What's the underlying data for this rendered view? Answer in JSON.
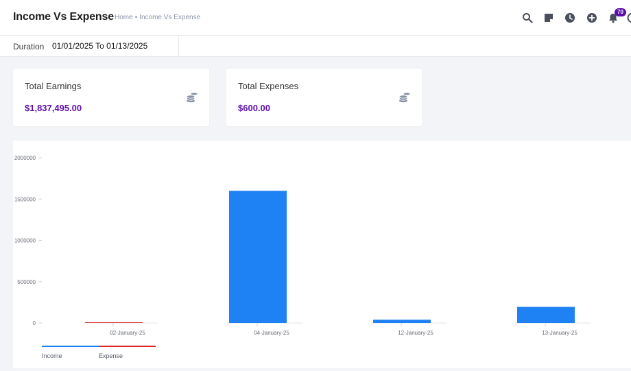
{
  "header": {
    "title": "Income Vs Expense",
    "breadcrumb": {
      "home": "Home",
      "separator": "•",
      "current": "Income Vs Expense"
    },
    "notification_count": "70"
  },
  "filter": {
    "label": "Duration",
    "value": "01/01/2025 To 01/13/2025"
  },
  "cards": {
    "earnings": {
      "label": "Total Earnings",
      "value": "$1,837,495.00",
      "icon": "coins-icon"
    },
    "expenses": {
      "label": "Total Expenses",
      "value": "$600.00",
      "icon": "coins-icon"
    }
  },
  "colors": {
    "accent": "#5b0fa8",
    "income": "#1e82f5",
    "expense": "#e02424"
  },
  "chart_data": {
    "type": "bar",
    "categories": [
      "02-January-25",
      "04-January-25",
      "12-January-25",
      "13-January-25"
    ],
    "series": [
      {
        "name": "Income",
        "values": [
          0,
          1600000,
          40000,
          195000
        ]
      },
      {
        "name": "Expense",
        "values": [
          600,
          0,
          0,
          0
        ]
      }
    ],
    "yticks": [
      "0",
      "500000",
      "1000000",
      "1500000",
      "2000000"
    ],
    "ylim": [
      0,
      2000000
    ],
    "grid": false,
    "legend": "bottom-left"
  }
}
